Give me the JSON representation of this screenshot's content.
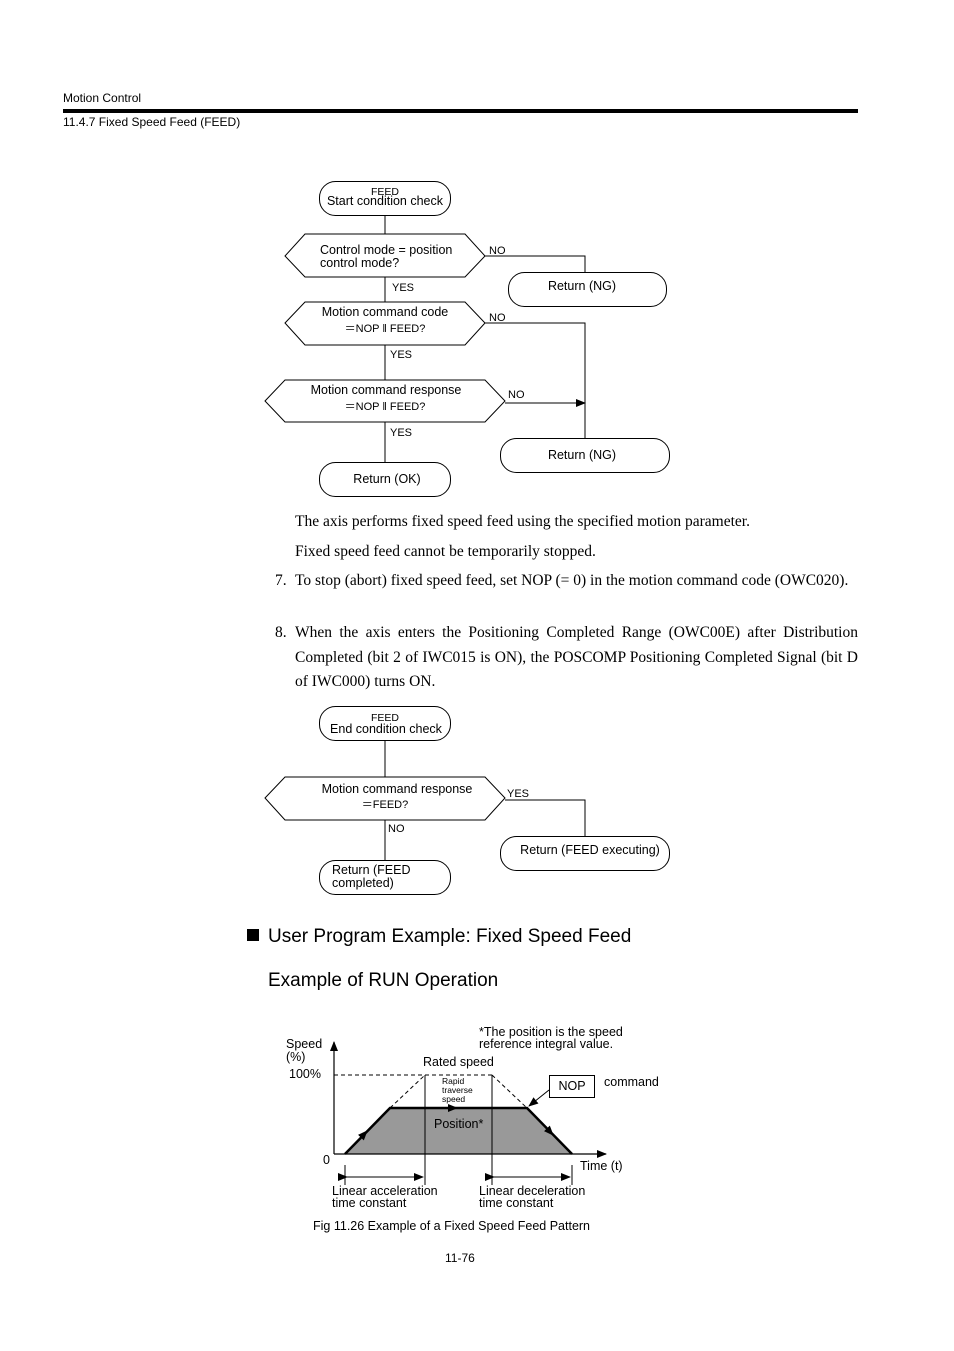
{
  "header": {
    "section": "Motion Control",
    "subsection": "11.4.7  Fixed Speed Feed (FEED)"
  },
  "flow1": {
    "start_top": "FEED",
    "start_bottom": "Start condition check",
    "d1_line1": "Control mode = position",
    "d1_line2": "control mode?",
    "d1_no": "NO",
    "d1_yes": "YES",
    "ret_ng1": "Return (NG)",
    "d2_line1": "Motion command code",
    "d2_line2": "＝NOP ‖ FEED?",
    "d2_no": "NO",
    "d2_yes": "YES",
    "d3_line1": "Motion command response",
    "d3_line2": "＝NOP ‖ FEED?",
    "d3_no": "NO",
    "d3_yes": "YES",
    "ret_ng2": "Return (NG)",
    "ret_ok": "Return (OK)"
  },
  "body": {
    "p1": "The axis performs fixed speed feed using the specified motion parameter.",
    "p2": "Fixed speed feed cannot be temporarily stopped.",
    "items": [
      {
        "num": "7.",
        "text": "To stop (abort) fixed speed feed, set NOP (= 0) in the motion command code (OWC020)."
      },
      {
        "num": "8.",
        "text": "When the axis enters the Positioning Completed Range (OWC00E) after Distribution Completed (bit 2 of IWC015 is ON), the POSCOMP Positioning Completed Signal (bit D of IWC000) turns ON."
      }
    ]
  },
  "flow2": {
    "start_top": "FEED",
    "start_bottom": "End condition check",
    "d1_line1": "Motion command response",
    "d1_line2": "＝FEED?",
    "d1_yes": "YES",
    "d1_no": "NO",
    "ret_exec": "Return (FEED executing)",
    "ret_done1": "Return (FEED",
    "ret_done2": "completed)"
  },
  "section": {
    "title": "User Program Example: Fixed Speed Feed",
    "subtitle": "Example of RUN Operation"
  },
  "figure": {
    "y_label1": "Speed",
    "y_label2": "(%)",
    "y_100": "100%",
    "y_0": "0",
    "x_label": "Time (t)",
    "note1": "*The position is the speed",
    "note2": "reference integral value.",
    "rated": "Rated speed",
    "rapid1": "Rapid",
    "rapid2": "traverse",
    "rapid3": "speed",
    "position": "Position*",
    "nop": "NOP",
    "command": "command",
    "acc1": "Linear acceleration",
    "acc2": "time constant",
    "dec1": "Linear deceleration",
    "dec2": "time constant",
    "caption": "Fig 11.26  Example of a Fixed Speed Feed Pattern",
    "fill_color": "#999999"
  },
  "footer": {
    "page": "11-76"
  }
}
